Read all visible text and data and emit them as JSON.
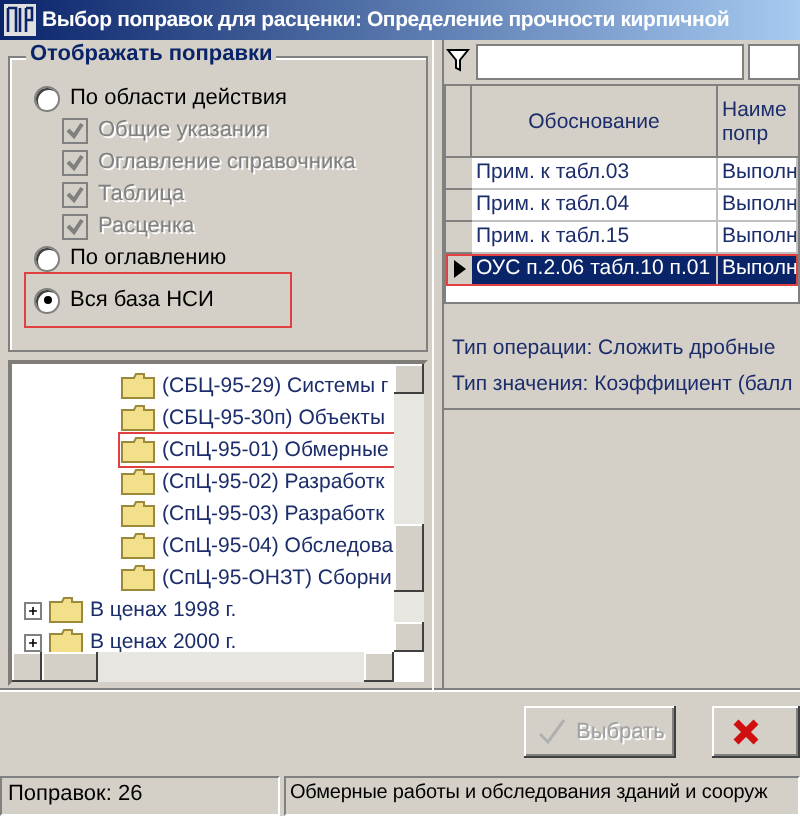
{
  "window": {
    "title": "Выбор поправок для расценки: Определение прочности кирпичной"
  },
  "filter_group": {
    "title": "Отображать поправки",
    "options": [
      {
        "kind": "radio",
        "label": "По области действия",
        "selected": false,
        "disabled": false
      },
      {
        "kind": "checkbox",
        "label": "Общие указания",
        "checked": true,
        "disabled": true
      },
      {
        "kind": "checkbox",
        "label": "Оглавление справочника",
        "checked": true,
        "disabled": true
      },
      {
        "kind": "checkbox",
        "label": "Таблица",
        "checked": true,
        "disabled": true
      },
      {
        "kind": "checkbox",
        "label": "Расценка",
        "checked": true,
        "disabled": true
      },
      {
        "kind": "radio",
        "label": "По оглавлению",
        "selected": false,
        "disabled": false
      },
      {
        "kind": "radio",
        "label": "Вся база НСИ",
        "selected": true,
        "disabled": false,
        "highlighted": true
      }
    ]
  },
  "tree": {
    "items": [
      {
        "children": [
          {
            "label": "(СБЦ-95-29) Системы г"
          },
          {
            "label": "(СБЦ-95-30п) Объекты"
          },
          {
            "label": "(СпЦ-95-01) Обмерные",
            "highlighted": true
          },
          {
            "label": "(СпЦ-95-02) Разработк"
          },
          {
            "label": "(СпЦ-95-03) Разработк"
          },
          {
            "label": "(СпЦ-95-04) Обследова"
          },
          {
            "label": "(СпЦ-95-ОНЗТ) Сборни"
          }
        ]
      },
      {
        "label": "В ценах 1998 г.",
        "expanded": false
      },
      {
        "label": "В ценах 2000 г.",
        "expanded": false
      }
    ]
  },
  "table": {
    "columns": [
      "Обоснование",
      "Наиме попр"
    ],
    "rows": [
      {
        "cells": [
          "Прим. к табл.03",
          "Выполн"
        ],
        "selected": false
      },
      {
        "cells": [
          "Прим. к табл.04",
          "Выполн"
        ],
        "selected": false
      },
      {
        "cells": [
          "Прим. к табл.15",
          "Выполн"
        ],
        "selected": false
      },
      {
        "cells": [
          "ОУС п.2.06 табл.10 п.01",
          "Выполн"
        ],
        "selected": true,
        "highlighted": true
      }
    ]
  },
  "details": [
    "Тип операции: Сложить дробные",
    "Тип значения: Коэффициент (балл"
  ],
  "buttons": [
    {
      "kind": "select",
      "label": "Выбрать",
      "disabled": true
    },
    {
      "kind": "cancel",
      "disabled": false
    }
  ],
  "status_bar": [
    "Поправок: 26",
    "Обмерные работы и обследования зданий и сооруж"
  ]
}
